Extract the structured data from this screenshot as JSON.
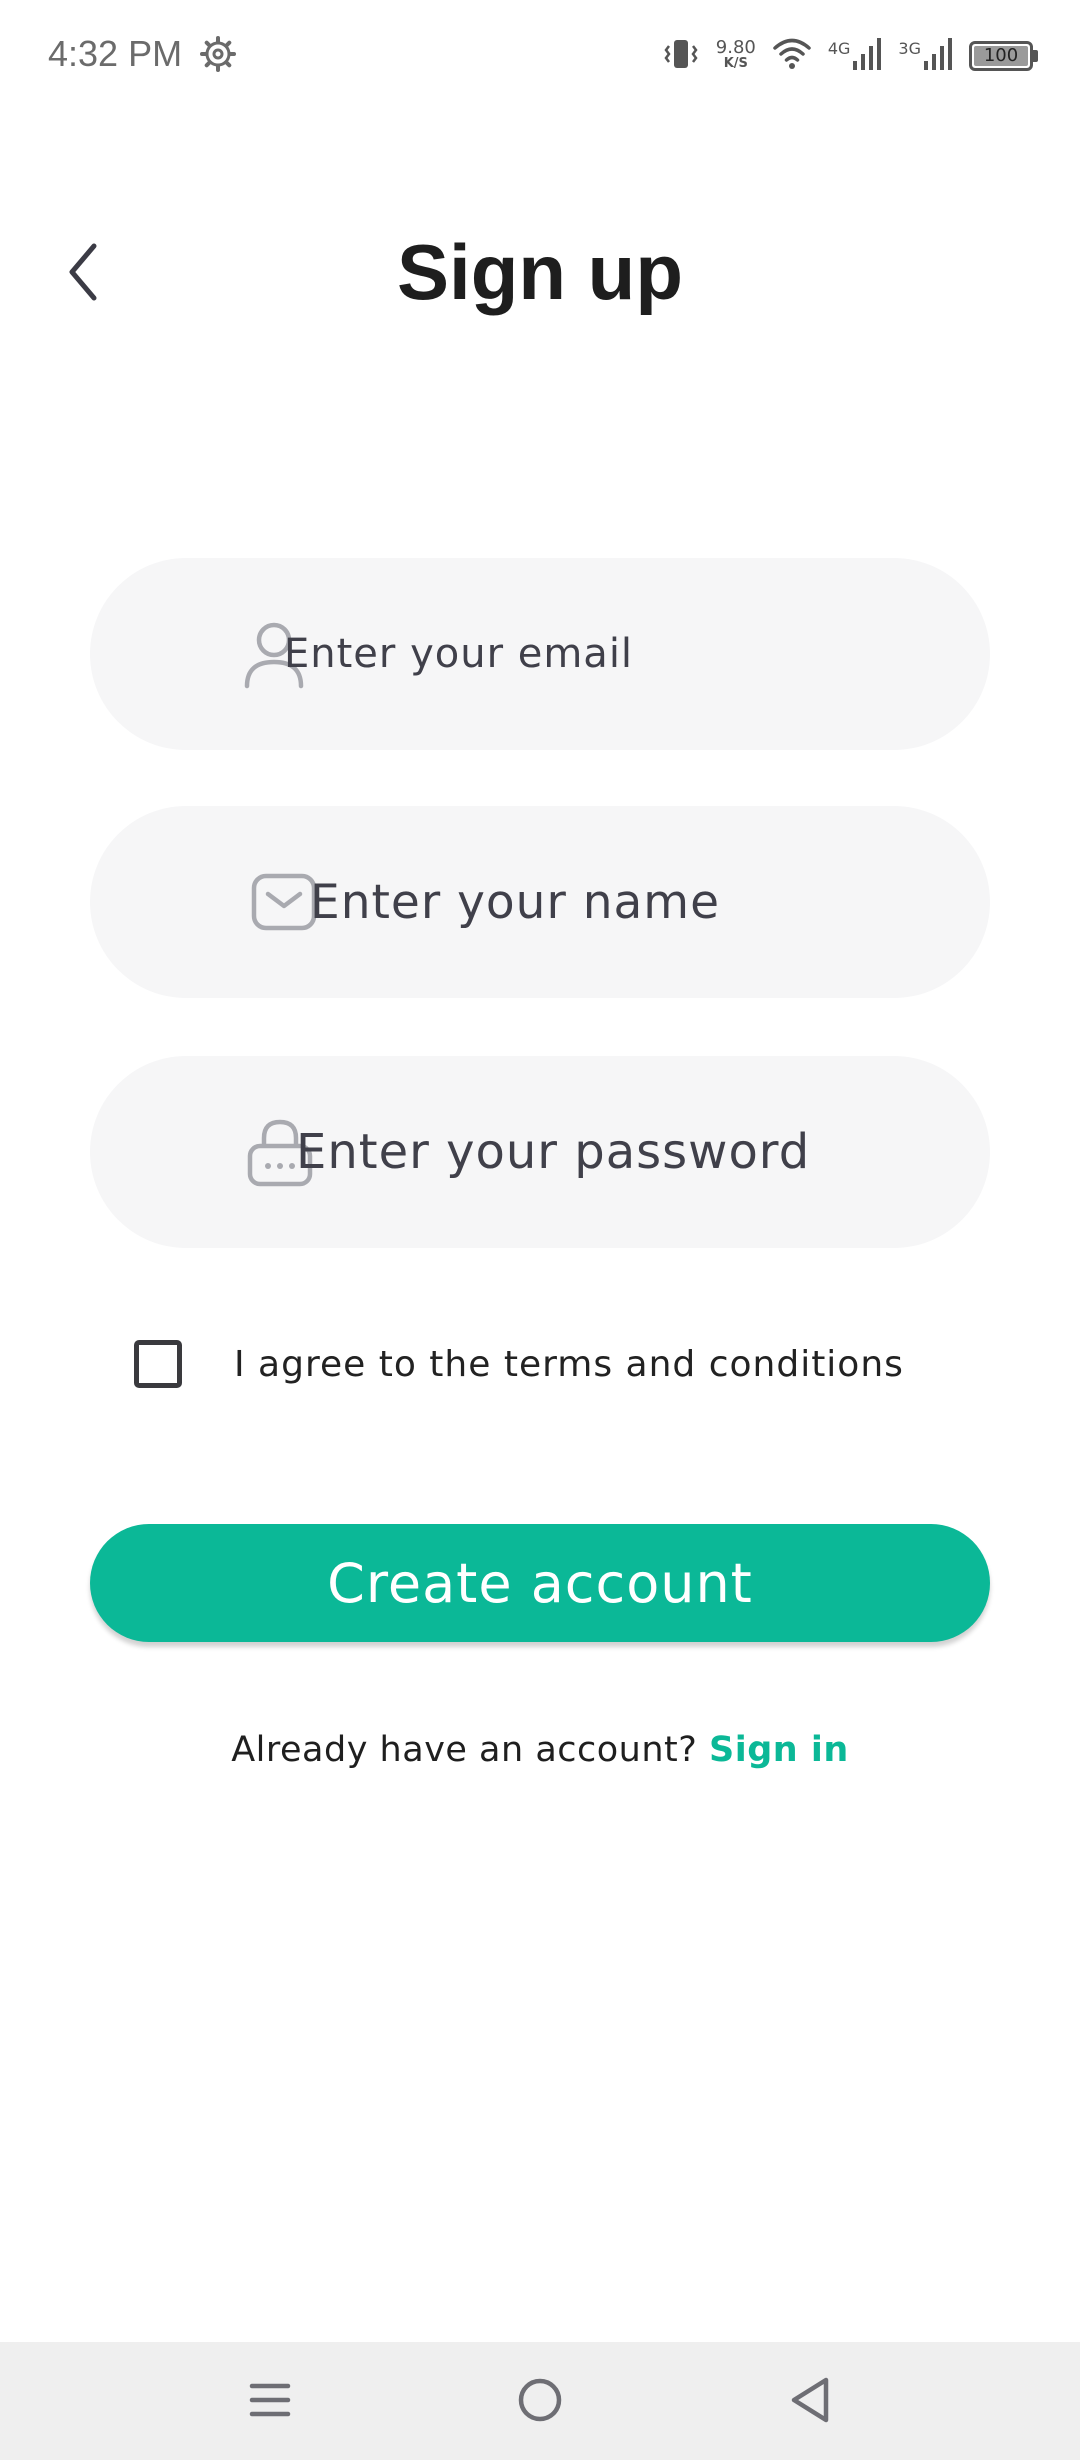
{
  "status_bar": {
    "time": "4:32 PM",
    "net_speed_value": "9.80",
    "net_speed_unit": "K/S",
    "network_1": "4G",
    "network_2": "3G",
    "battery": "100",
    "icons": [
      "gear-icon",
      "vibrate-icon",
      "wifi-icon",
      "signal-icon",
      "signal-icon",
      "battery-icon"
    ]
  },
  "header": {
    "title": "Sign up",
    "back_icon": "chevron-left-icon"
  },
  "form": {
    "email": {
      "placeholder": "Enter your email",
      "value": "",
      "icon": "user-icon"
    },
    "name": {
      "placeholder": "Enter your name",
      "value": "",
      "icon": "mail-icon"
    },
    "password": {
      "placeholder": "Enter your password",
      "value": "",
      "icon": "lock-icon"
    },
    "terms": {
      "label": "I agree to the terms and conditions",
      "checked": false
    },
    "submit_label": "Create account"
  },
  "footer": {
    "prompt": "Already have an account?",
    "link": "Sign in"
  },
  "colors": {
    "accent": "#0bb897",
    "field_bg": "#f6f6f7",
    "title": "#1e1e1e"
  },
  "nav_bar": {
    "icons": [
      "menu-icon",
      "home-icon",
      "back-icon"
    ]
  }
}
